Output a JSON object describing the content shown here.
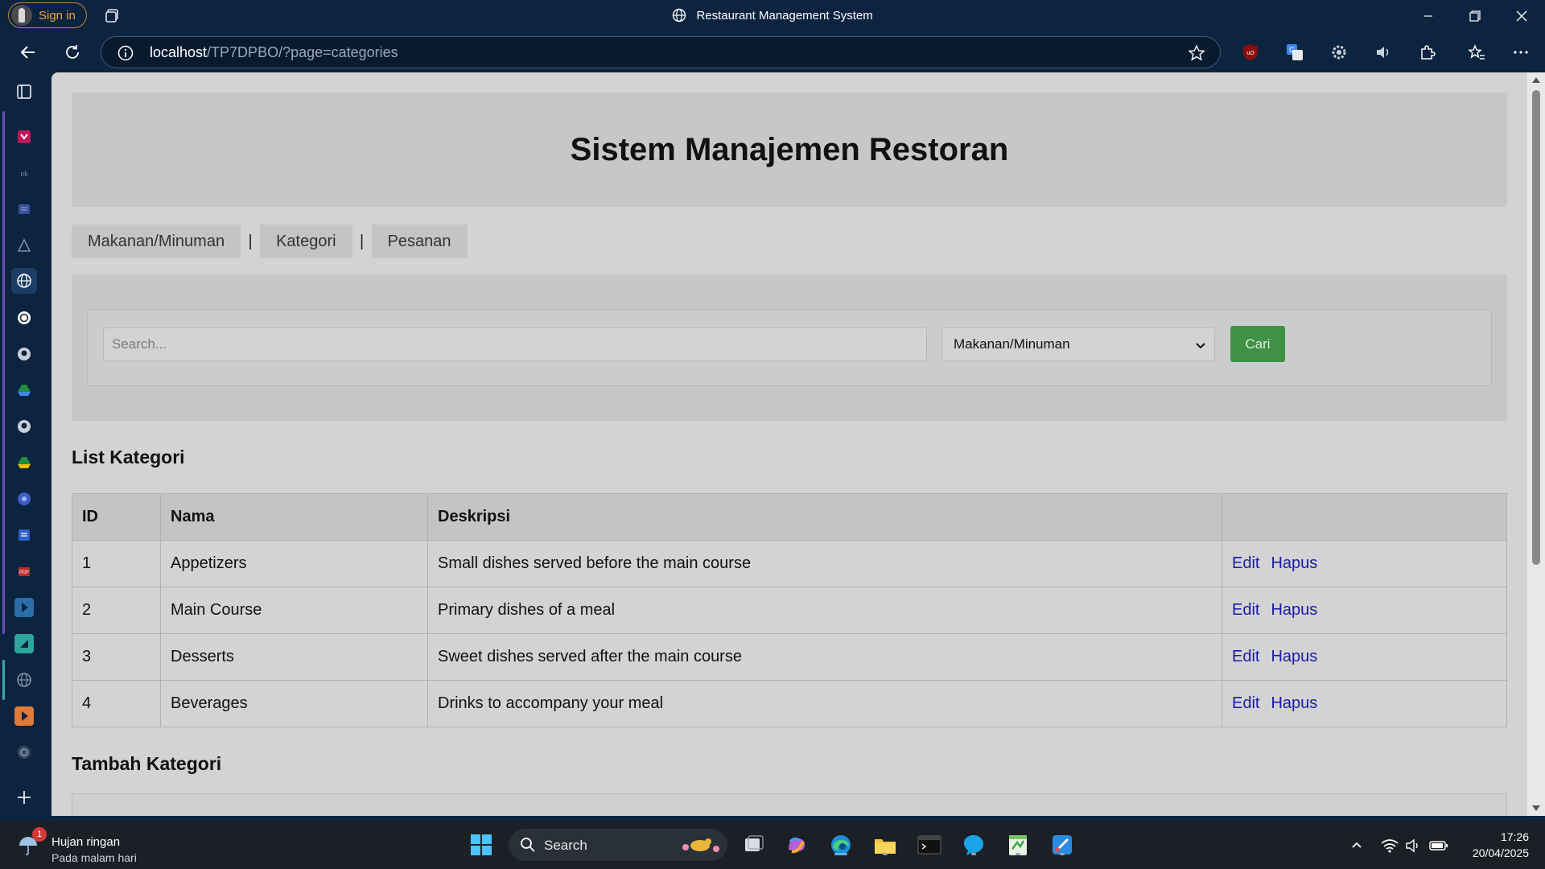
{
  "browser": {
    "signin_label": "Sign in",
    "tab_title": "Restaurant Management System",
    "url_host": "localhost",
    "url_path": "/TP7DPBO/?page=categories"
  },
  "page": {
    "title": "Sistem Manajemen Restoran",
    "nav": [
      {
        "label": "Makanan/Minuman"
      },
      {
        "label": "Kategori"
      },
      {
        "label": "Pesanan"
      }
    ],
    "separator": "|",
    "search": {
      "placeholder": "Search...",
      "select_value": "Makanan/Minuman",
      "button_label": "Cari"
    },
    "list_heading": "List Kategori",
    "table": {
      "headers": [
        "ID",
        "Nama",
        "Deskripsi",
        ""
      ],
      "rows": [
        {
          "id": "1",
          "name": "Appetizers",
          "desc": "Small dishes served before the main course",
          "edit": "Edit",
          "delete": "Hapus"
        },
        {
          "id": "2",
          "name": "Main Course",
          "desc": "Primary dishes of a meal",
          "edit": "Edit",
          "delete": "Hapus"
        },
        {
          "id": "3",
          "name": "Desserts",
          "desc": "Sweet dishes served after the main course",
          "edit": "Edit",
          "delete": "Hapus"
        },
        {
          "id": "4",
          "name": "Beverages",
          "desc": "Drinks to accompany your meal",
          "edit": "Edit",
          "delete": "Hapus"
        }
      ]
    },
    "add_heading": "Tambah Kategori"
  },
  "taskbar": {
    "weather_title": "Hujan ringan",
    "weather_sub": "Pada malam hari",
    "weather_badge": "1",
    "search_label": "Search",
    "time": "17:26",
    "date": "20/04/2025"
  },
  "colors": {
    "chrome_bg": "#0d2440",
    "page_bg": "#d3d3d3",
    "button_green": "#3f9145",
    "link_blue": "#1a1aa6"
  }
}
